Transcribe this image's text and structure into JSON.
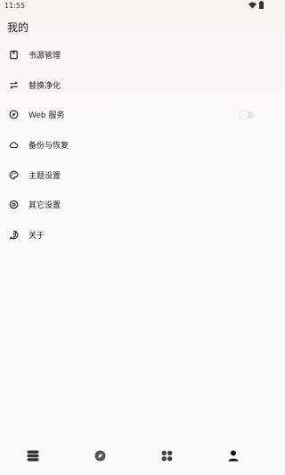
{
  "status_bar": {
    "time": "11:55",
    "icons": [
      "wifi-icon",
      "battery-icon"
    ]
  },
  "page": {
    "title": "我的"
  },
  "menu": {
    "items": [
      {
        "label": "书源管理",
        "icon": "book-source-icon"
      },
      {
        "label": "替换净化",
        "icon": "swap-icon"
      },
      {
        "label": "Web 服务",
        "icon": "compass-icon",
        "toggle": false
      },
      {
        "label": "备份与恢复",
        "icon": "cloud-icon"
      },
      {
        "label": "主题设置",
        "icon": "palette-icon"
      },
      {
        "label": "其它设置",
        "icon": "settings-icon"
      },
      {
        "label": "关于",
        "icon": "info-icon"
      }
    ]
  },
  "bottom_nav": {
    "items": [
      {
        "name": "bookshelf",
        "icon": "bookshelf-icon"
      },
      {
        "name": "discover",
        "icon": "compass-icon"
      },
      {
        "name": "rss",
        "icon": "grid-icon"
      },
      {
        "name": "mine",
        "icon": "person-icon",
        "active": true
      }
    ]
  },
  "colors": {
    "text": "#222222",
    "toggle_track": "#e6e6e6",
    "background": "#fafafa"
  }
}
